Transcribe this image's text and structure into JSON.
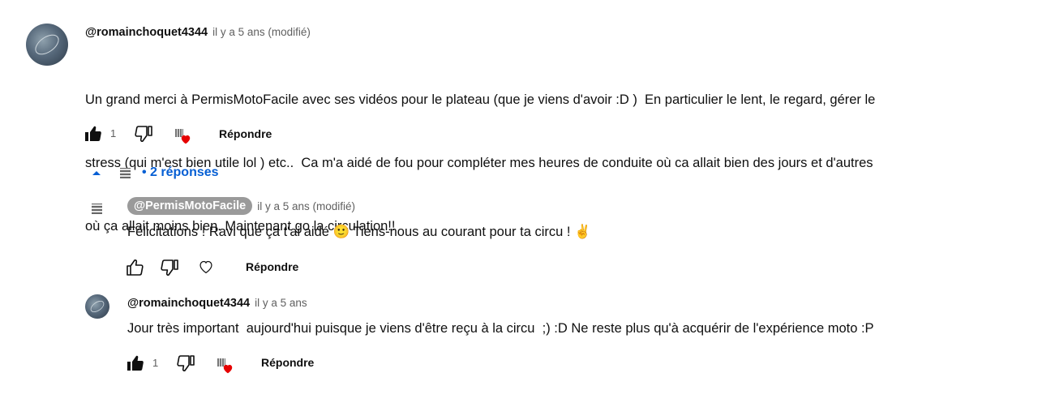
{
  "comment": {
    "author": "@romainchoquet4344",
    "time": "il y a 5 ans (modifié)",
    "text_line1": "Un grand merci à PermisMotoFacile avec ses vidéos pour le plateau (que je viens d'avoir :D )  En particulier le lent, le regard, gérer le",
    "text_line2": "stress (qui m'est bien utile lol ) etc..  Ca m'a aidé de fou pour compléter mes heures de conduite où ca allait bien des jours et d'autres",
    "text_line3": "où ça allait moins bien. Maintenant go la circulation!!",
    "likes": "1",
    "reply_label": "Répondre"
  },
  "replies_toggle": {
    "label": "• 2 réponses"
  },
  "reply1": {
    "author": "@PermisMotoFacile",
    "time": "il y a 5 ans (modifié)",
    "text": "Félicitations ! Ravi que ça t'ai aidé 🙂 Tiens-nous au courant pour ta circu ! ✌️",
    "reply_label": "Répondre"
  },
  "reply2": {
    "author": "@romainchoquet4344",
    "time": "il y a 5 ans",
    "text": "Jour très important  aujourd'hui puisque je viens d'être reçu à la circu  ;) :D Ne reste plus qu'à acquérir de l'expérience moto :P",
    "likes": "1",
    "reply_label": "Répondre"
  },
  "icons": {
    "like_filled": "thumbs-up-filled-icon",
    "dislike": "thumbs-down-icon",
    "like_outline": "thumbs-up-outline-icon",
    "heart": "heart-icon",
    "creator_heart": "creator-heart-icon",
    "chevron": "chevron-up-icon"
  },
  "colors": {
    "link_blue": "#065fd4",
    "heart_red": "#e60000",
    "meta_gray": "#606060",
    "chip_gray": "#9a9a9a"
  }
}
